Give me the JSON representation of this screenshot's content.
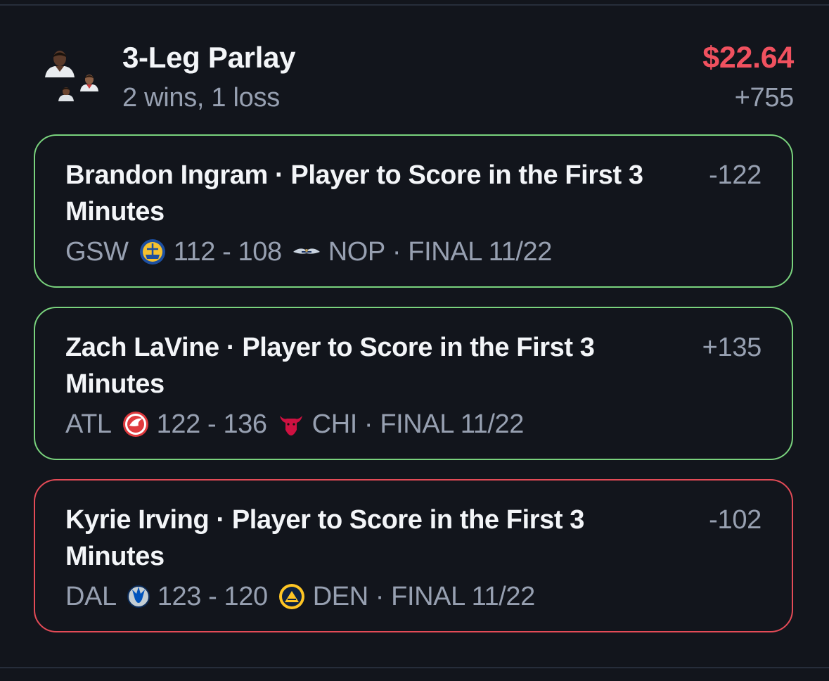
{
  "parlay": {
    "title": "3-Leg Parlay",
    "record": "2 wins, 1 loss",
    "payout": "$22.64",
    "odds": "+755"
  },
  "legs": [
    {
      "title": "Brandon Ingram · Player to Score in the First 3 Minutes",
      "odds": "-122",
      "status": "won",
      "away_team": "GSW",
      "away_logo": "warriors-logo-icon",
      "score": "112 - 108",
      "home_team": "NOP",
      "home_logo": "pelicans-logo-icon",
      "result": "· FINAL 11/22"
    },
    {
      "title": "Zach LaVine · Player to Score in the First 3 Minutes",
      "odds": "+135",
      "status": "won",
      "away_team": "ATL",
      "away_logo": "hawks-logo-icon",
      "score": "122 - 136",
      "home_team": "CHI",
      "home_logo": "bulls-logo-icon",
      "result": "· FINAL 11/22"
    },
    {
      "title": "Kyrie Irving · Player to Score in the First 3 Minutes",
      "odds": "-102",
      "status": "lost",
      "away_team": "DAL",
      "away_logo": "mavericks-logo-icon",
      "score": "123 - 120",
      "home_team": "DEN",
      "home_logo": "nuggets-logo-icon",
      "result": "· FINAL 11/22"
    }
  ],
  "colors": {
    "background": "#12151c",
    "won_border": "#79d27d",
    "lost_border": "#e44b57",
    "payout_red": "#f0515f",
    "muted_text": "#97a0b1"
  }
}
